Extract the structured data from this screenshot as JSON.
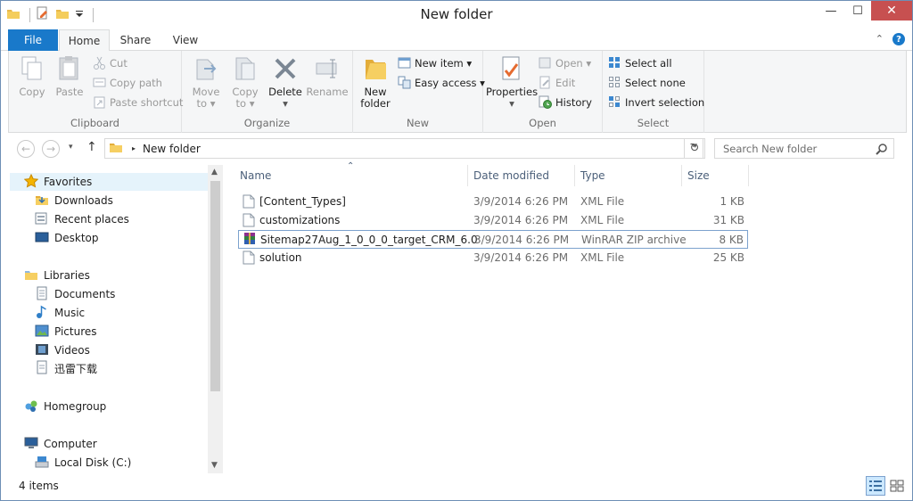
{
  "window": {
    "title": "New folder"
  },
  "titlebar": {
    "minimize": "—",
    "maximize": "☐",
    "close": "✕"
  },
  "tabs": {
    "file": "File",
    "home": "Home",
    "share": "Share",
    "view": "View",
    "collapse": "⌃",
    "help": "?"
  },
  "ribbon": {
    "clipboard": {
      "label": "Clipboard",
      "copy": "Copy",
      "paste": "Paste",
      "cut": "Cut",
      "copy_path": "Copy path",
      "paste_shortcut": "Paste shortcut"
    },
    "organize": {
      "label": "Organize",
      "move_to_1": "Move",
      "move_to_2": "to ▾",
      "copy_to_1": "Copy",
      "copy_to_2": "to ▾",
      "delete": "Delete",
      "delete_arrow": "▾",
      "rename": "Rename"
    },
    "new": {
      "label": "New",
      "new_folder_1": "New",
      "new_folder_2": "folder",
      "new_item": "New item ▾",
      "easy_access": "Easy access ▾"
    },
    "open": {
      "label": "Open",
      "properties": "Properties",
      "properties_arrow": "▾",
      "open": "Open ▾",
      "edit": "Edit",
      "history": "History"
    },
    "select": {
      "label": "Select",
      "select_all": "Select all",
      "select_none": "Select none",
      "invert_selection": "Invert selection"
    }
  },
  "address": {
    "breadcrumb": "New folder",
    "search_placeholder": "Search New folder",
    "back": "←",
    "forward": "→",
    "up": "↑",
    "refresh": "↻",
    "dropdown": "▾",
    "separator": "▸"
  },
  "nav": {
    "favorites": "Favorites",
    "downloads": "Downloads",
    "recent_places": "Recent places",
    "desktop": "Desktop",
    "libraries": "Libraries",
    "documents": "Documents",
    "music": "Music",
    "pictures": "Pictures",
    "videos": "Videos",
    "thunder": "迅雷下载",
    "homegroup": "Homegroup",
    "computer": "Computer",
    "local_disk": "Local Disk (C:)"
  },
  "columns": {
    "name": "Name",
    "date_modified": "Date modified",
    "type": "Type",
    "size": "Size",
    "sort_arrow": "⌃"
  },
  "files": [
    {
      "name": "[Content_Types]",
      "date": "3/9/2014 6:26 PM",
      "type": "XML File",
      "size": "1 KB",
      "icon": "xml-file-icon"
    },
    {
      "name": "customizations",
      "date": "3/9/2014 6:26 PM",
      "type": "XML File",
      "size": "31 KB",
      "icon": "xml-file-icon"
    },
    {
      "name": "Sitemap27Aug_1_0_0_0_target_CRM_6.0",
      "date": "3/9/2014 6:26 PM",
      "type": "WinRAR ZIP archive",
      "size": "8 KB",
      "icon": "winrar-archive-icon",
      "selected": true
    },
    {
      "name": "solution",
      "date": "3/9/2014 6:26 PM",
      "type": "XML File",
      "size": "25 KB",
      "icon": "xml-file-icon"
    }
  ],
  "status": {
    "item_count": "4 items"
  },
  "colors": {
    "accent": "#1979ca",
    "close": "#c75050",
    "selection_border": "#7da2ce",
    "hover": "#e5f3fb"
  }
}
